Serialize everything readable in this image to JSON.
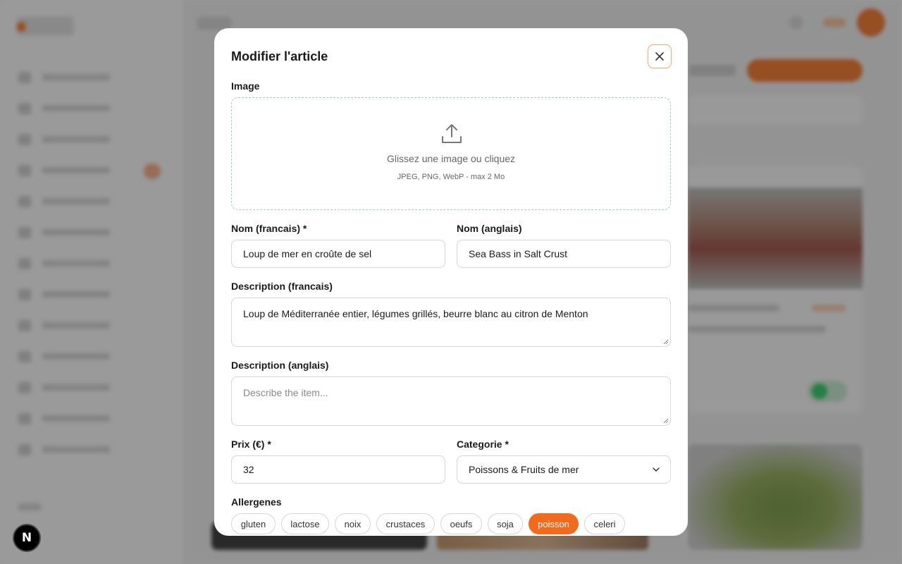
{
  "modal": {
    "title": "Modifier l'article",
    "close_icon": "close-icon",
    "image": {
      "label": "Image",
      "icon": "upload-icon",
      "prompt": "Glissez une image ou cliquez",
      "hint": "JPEG, PNG, WebP - max 2 Mo"
    },
    "name_fr": {
      "label": "Nom (francais) *",
      "value": "Loup de mer en croûte de sel"
    },
    "name_en": {
      "label": "Nom (anglais)",
      "value": "Sea Bass in Salt Crust"
    },
    "desc_fr": {
      "label": "Description (francais)",
      "value": "Loup de Méditerranée entier, légumes grillés, beurre blanc au citron de Menton"
    },
    "desc_en": {
      "label": "Description (anglais)",
      "placeholder": "Describe the item..."
    },
    "price": {
      "label": "Prix (€) *",
      "value": "32"
    },
    "category": {
      "label": "Categorie *",
      "value": "Poissons & Fruits de mer",
      "icon": "chevron-down-icon"
    },
    "allergens": {
      "label": "Allergenes",
      "items": [
        {
          "label": "gluten",
          "selected": false
        },
        {
          "label": "lactose",
          "selected": false
        },
        {
          "label": "noix",
          "selected": false
        },
        {
          "label": "crustaces",
          "selected": false
        },
        {
          "label": "oeufs",
          "selected": false
        },
        {
          "label": "soja",
          "selected": false
        },
        {
          "label": "poisson",
          "selected": true
        },
        {
          "label": "celeri",
          "selected": false
        }
      ]
    }
  },
  "dev_badge": {
    "label": "N"
  },
  "colors": {
    "accent": "#f26a1b",
    "close_border": "#f4a374",
    "dropzone_border": "#a9c9c0"
  }
}
